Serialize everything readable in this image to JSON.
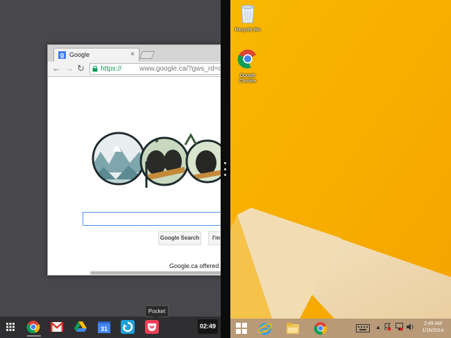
{
  "chrome_window": {
    "tab_title": "Google",
    "tab_favicon": "g",
    "tab_close": "×",
    "url_scheme": "https://",
    "url_rest": "www.google.ca/?gws_rd=cr&ei=",
    "search_button": "Google Search",
    "lucky_button": "I'm",
    "offered_in": "Google.ca offered in"
  },
  "shelf": {
    "pocket_tooltip": "Pocket",
    "clock": "02:49",
    "calendar_day": "31",
    "items": [
      "launcher-icon",
      "chrome-icon",
      "gmail-icon",
      "google-drive-icon",
      "calendar-icon",
      "drop-app-icon",
      "pocket-icon"
    ]
  },
  "desktop": {
    "recycle_bin_label": "Recycle Bin",
    "chrome_label_1": "Google",
    "chrome_label_2": "Chrome",
    "background_color": "#f7a900"
  },
  "taskbar": {
    "time": "2:49 AM",
    "date": "1/16/2014",
    "tray_chevron": "▲"
  },
  "colors": {
    "left_pane_bg": "#48484c",
    "shelf_bg": "#2e2e30",
    "win_taskbar_bg": "#b89a78"
  }
}
